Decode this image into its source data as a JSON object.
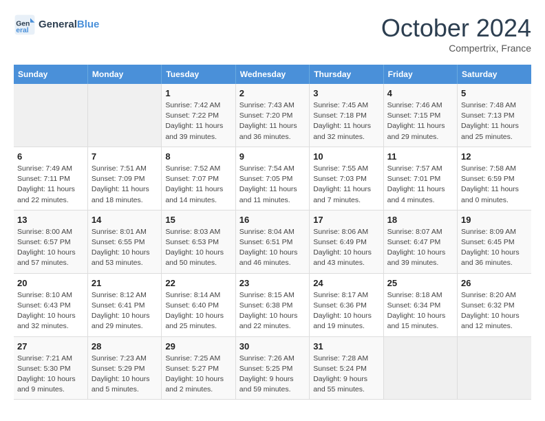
{
  "header": {
    "logo_line1": "General",
    "logo_line2": "Blue",
    "month": "October 2024",
    "location": "Compertrix, France"
  },
  "weekdays": [
    "Sunday",
    "Monday",
    "Tuesday",
    "Wednesday",
    "Thursday",
    "Friday",
    "Saturday"
  ],
  "weeks": [
    [
      {
        "day": "",
        "detail": ""
      },
      {
        "day": "",
        "detail": ""
      },
      {
        "day": "1",
        "detail": "Sunrise: 7:42 AM\nSunset: 7:22 PM\nDaylight: 11 hours and 39 minutes."
      },
      {
        "day": "2",
        "detail": "Sunrise: 7:43 AM\nSunset: 7:20 PM\nDaylight: 11 hours and 36 minutes."
      },
      {
        "day": "3",
        "detail": "Sunrise: 7:45 AM\nSunset: 7:18 PM\nDaylight: 11 hours and 32 minutes."
      },
      {
        "day": "4",
        "detail": "Sunrise: 7:46 AM\nSunset: 7:15 PM\nDaylight: 11 hours and 29 minutes."
      },
      {
        "day": "5",
        "detail": "Sunrise: 7:48 AM\nSunset: 7:13 PM\nDaylight: 11 hours and 25 minutes."
      }
    ],
    [
      {
        "day": "6",
        "detail": "Sunrise: 7:49 AM\nSunset: 7:11 PM\nDaylight: 11 hours and 22 minutes."
      },
      {
        "day": "7",
        "detail": "Sunrise: 7:51 AM\nSunset: 7:09 PM\nDaylight: 11 hours and 18 minutes."
      },
      {
        "day": "8",
        "detail": "Sunrise: 7:52 AM\nSunset: 7:07 PM\nDaylight: 11 hours and 14 minutes."
      },
      {
        "day": "9",
        "detail": "Sunrise: 7:54 AM\nSunset: 7:05 PM\nDaylight: 11 hours and 11 minutes."
      },
      {
        "day": "10",
        "detail": "Sunrise: 7:55 AM\nSunset: 7:03 PM\nDaylight: 11 hours and 7 minutes."
      },
      {
        "day": "11",
        "detail": "Sunrise: 7:57 AM\nSunset: 7:01 PM\nDaylight: 11 hours and 4 minutes."
      },
      {
        "day": "12",
        "detail": "Sunrise: 7:58 AM\nSunset: 6:59 PM\nDaylight: 11 hours and 0 minutes."
      }
    ],
    [
      {
        "day": "13",
        "detail": "Sunrise: 8:00 AM\nSunset: 6:57 PM\nDaylight: 10 hours and 57 minutes."
      },
      {
        "day": "14",
        "detail": "Sunrise: 8:01 AM\nSunset: 6:55 PM\nDaylight: 10 hours and 53 minutes."
      },
      {
        "day": "15",
        "detail": "Sunrise: 8:03 AM\nSunset: 6:53 PM\nDaylight: 10 hours and 50 minutes."
      },
      {
        "day": "16",
        "detail": "Sunrise: 8:04 AM\nSunset: 6:51 PM\nDaylight: 10 hours and 46 minutes."
      },
      {
        "day": "17",
        "detail": "Sunrise: 8:06 AM\nSunset: 6:49 PM\nDaylight: 10 hours and 43 minutes."
      },
      {
        "day": "18",
        "detail": "Sunrise: 8:07 AM\nSunset: 6:47 PM\nDaylight: 10 hours and 39 minutes."
      },
      {
        "day": "19",
        "detail": "Sunrise: 8:09 AM\nSunset: 6:45 PM\nDaylight: 10 hours and 36 minutes."
      }
    ],
    [
      {
        "day": "20",
        "detail": "Sunrise: 8:10 AM\nSunset: 6:43 PM\nDaylight: 10 hours and 32 minutes."
      },
      {
        "day": "21",
        "detail": "Sunrise: 8:12 AM\nSunset: 6:41 PM\nDaylight: 10 hours and 29 minutes."
      },
      {
        "day": "22",
        "detail": "Sunrise: 8:14 AM\nSunset: 6:40 PM\nDaylight: 10 hours and 25 minutes."
      },
      {
        "day": "23",
        "detail": "Sunrise: 8:15 AM\nSunset: 6:38 PM\nDaylight: 10 hours and 22 minutes."
      },
      {
        "day": "24",
        "detail": "Sunrise: 8:17 AM\nSunset: 6:36 PM\nDaylight: 10 hours and 19 minutes."
      },
      {
        "day": "25",
        "detail": "Sunrise: 8:18 AM\nSunset: 6:34 PM\nDaylight: 10 hours and 15 minutes."
      },
      {
        "day": "26",
        "detail": "Sunrise: 8:20 AM\nSunset: 6:32 PM\nDaylight: 10 hours and 12 minutes."
      }
    ],
    [
      {
        "day": "27",
        "detail": "Sunrise: 7:21 AM\nSunset: 5:30 PM\nDaylight: 10 hours and 9 minutes."
      },
      {
        "day": "28",
        "detail": "Sunrise: 7:23 AM\nSunset: 5:29 PM\nDaylight: 10 hours and 5 minutes."
      },
      {
        "day": "29",
        "detail": "Sunrise: 7:25 AM\nSunset: 5:27 PM\nDaylight: 10 hours and 2 minutes."
      },
      {
        "day": "30",
        "detail": "Sunrise: 7:26 AM\nSunset: 5:25 PM\nDaylight: 9 hours and 59 minutes."
      },
      {
        "day": "31",
        "detail": "Sunrise: 7:28 AM\nSunset: 5:24 PM\nDaylight: 9 hours and 55 minutes."
      },
      {
        "day": "",
        "detail": ""
      },
      {
        "day": "",
        "detail": ""
      }
    ]
  ]
}
